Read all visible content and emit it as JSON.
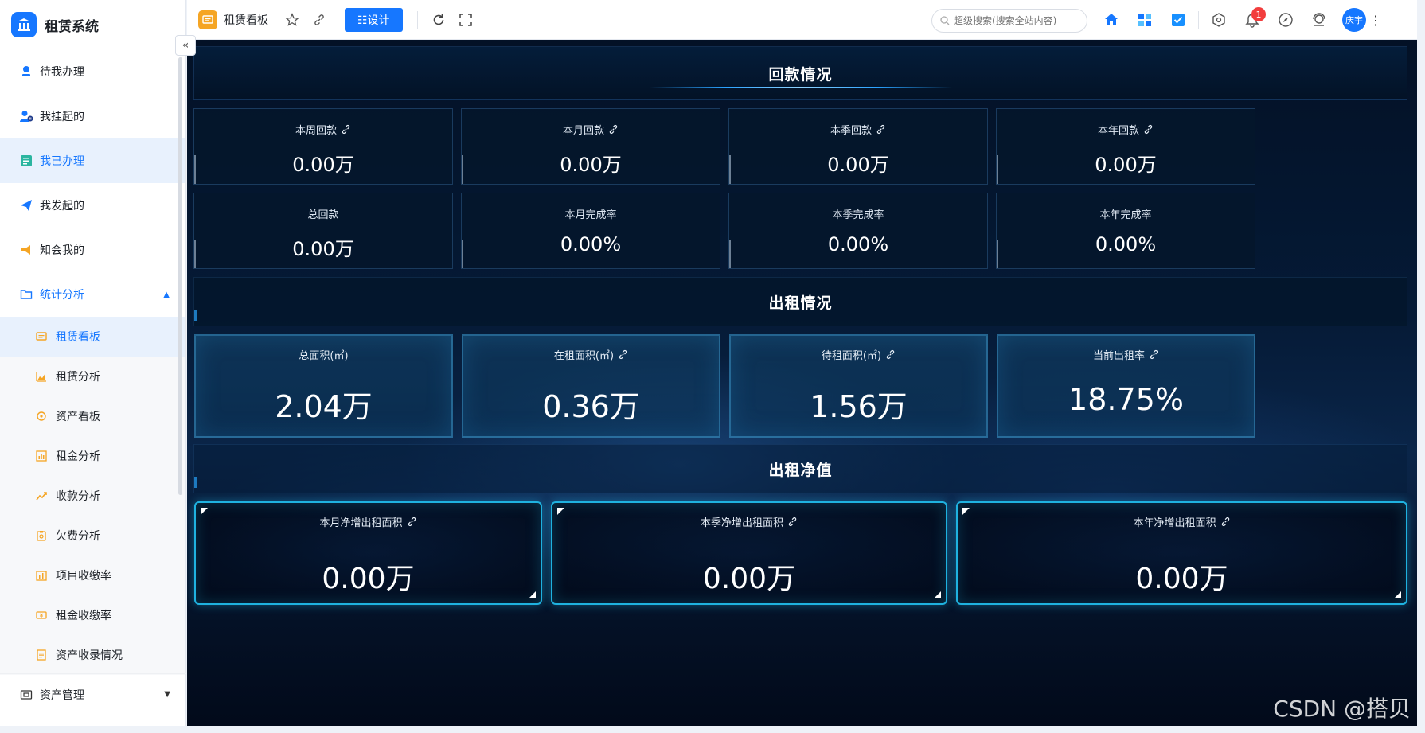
{
  "brand": {
    "title": "租赁系统"
  },
  "sidebar": {
    "items": [
      {
        "label": "待我办理",
        "icon": "person-stamp-icon"
      },
      {
        "label": "我挂起的",
        "icon": "person-pause-icon"
      },
      {
        "label": "我已办理",
        "icon": "done-list-icon"
      },
      {
        "label": "我发起的",
        "icon": "paper-plane-icon"
      },
      {
        "label": "知会我的",
        "icon": "megaphone-icon"
      }
    ],
    "group": {
      "label": "统计分析",
      "icon": "folder-icon"
    },
    "sub_items": [
      {
        "label": "租赁看板",
        "icon": "board-icon"
      },
      {
        "label": "租赁分析",
        "icon": "area-chart-icon"
      },
      {
        "label": "资产看板",
        "icon": "target-icon"
      },
      {
        "label": "租金分析",
        "icon": "bar-chart-icon"
      },
      {
        "label": "收款分析",
        "icon": "trend-icon"
      },
      {
        "label": "欠费分析",
        "icon": "clipboard-icon"
      },
      {
        "label": "项目收缴率",
        "icon": "calendar-chart-icon"
      },
      {
        "label": "租金收缴率",
        "icon": "ticket-icon"
      },
      {
        "label": "资产收录情况",
        "icon": "document-icon"
      }
    ],
    "bottom": {
      "label": "资产管理",
      "icon": "asset-icon"
    }
  },
  "topbar": {
    "tab_label": "租赁看板",
    "design_label": "☷设计",
    "search_placeholder": "超级搜索(搜索全站内容)",
    "notification_count": "1",
    "user_name": "庆宇"
  },
  "sections": {
    "payback": "回款情况",
    "rent": "出租情况",
    "net": "出租净值"
  },
  "payback_cards": [
    {
      "label": "本周回款",
      "value": "0.00万",
      "link": true
    },
    {
      "label": "本月回款",
      "value": "0.00万",
      "link": true
    },
    {
      "label": "本季回款",
      "value": "0.00万",
      "link": true
    },
    {
      "label": "本年回款",
      "value": "0.00万",
      "link": true
    },
    {
      "label": "总回款",
      "value": "0.00万",
      "link": false
    },
    {
      "label": "本月完成率",
      "value": "0.00%",
      "link": false
    },
    {
      "label": "本季完成率",
      "value": "0.00%",
      "link": false
    },
    {
      "label": "本年完成率",
      "value": "0.00%",
      "link": false
    }
  ],
  "rent_cards": [
    {
      "label": "总面积(㎡)",
      "value": "2.04万",
      "link": false
    },
    {
      "label": "在租面积(㎡)",
      "value": "0.36万",
      "link": true
    },
    {
      "label": "待租面积(㎡)",
      "value": "1.56万",
      "link": true
    },
    {
      "label": "当前出租率",
      "value": "18.75%",
      "link": true
    }
  ],
  "net_cards": [
    {
      "label": "本月净增出租面积",
      "value": "0.00万",
      "link": true
    },
    {
      "label": "本季净增出租面积",
      "value": "0.00万",
      "link": true
    },
    {
      "label": "本年净增出租面积",
      "value": "0.00万",
      "link": true
    }
  ],
  "watermark": "CSDN @搭贝",
  "colors": {
    "accent": "#1677ff",
    "dash_bg": "#031126",
    "neon": "#1fb2e0",
    "badge": "#f23d3d"
  }
}
